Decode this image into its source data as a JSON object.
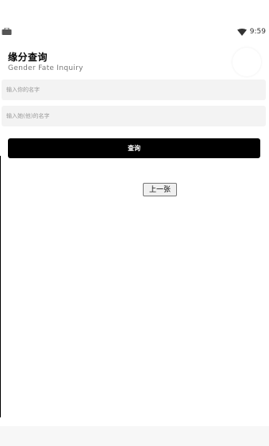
{
  "status_bar": {
    "time": "9:59",
    "left_icon": "briefcase-icon",
    "right_icon": "wifi-icon"
  },
  "header": {
    "title": "缘分查询",
    "subtitle": "Gender Fate Inquiry"
  },
  "form": {
    "your_name_placeholder": "输入你的名字",
    "partner_name_placeholder": "输入她(他)的名字",
    "your_name_value": "",
    "partner_name_value": ""
  },
  "actions": {
    "search_label": "查询",
    "previous_label": "上一张"
  },
  "colors": {
    "accent": "#000000",
    "input_bg": "#f3f3f3",
    "placeholder": "#9a9a9a"
  }
}
